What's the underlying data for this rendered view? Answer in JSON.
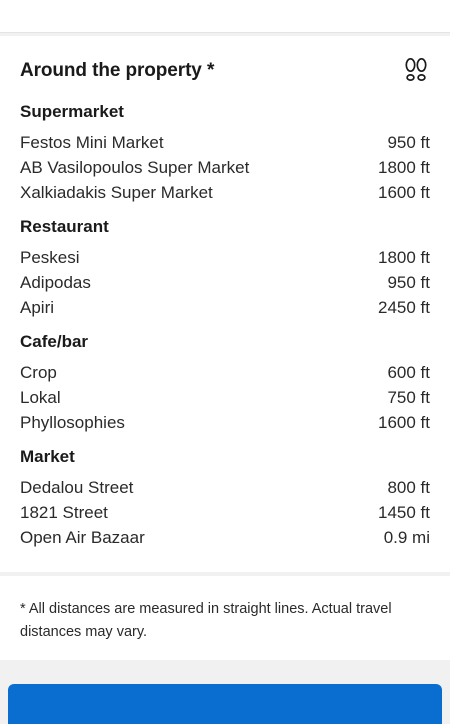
{
  "header": {
    "title": "Around the property *",
    "icon": "footprints-icon"
  },
  "sections": [
    {
      "title": "Supermarket",
      "items": [
        {
          "name": "Festos Mini Market",
          "distance": "950 ft"
        },
        {
          "name": "AB Vasilopoulos Super Market",
          "distance": "1800 ft"
        },
        {
          "name": "Xalkiadakis Super Market",
          "distance": "1600 ft"
        }
      ]
    },
    {
      "title": "Restaurant",
      "items": [
        {
          "name": "Peskesi",
          "distance": "1800 ft"
        },
        {
          "name": "Adipodas",
          "distance": "950 ft"
        },
        {
          "name": "Apiri",
          "distance": "2450 ft"
        }
      ]
    },
    {
      "title": "Cafe/bar",
      "items": [
        {
          "name": "Crop",
          "distance": "600 ft"
        },
        {
          "name": "Lokal",
          "distance": "750 ft"
        },
        {
          "name": "Phyllosophies",
          "distance": "1600 ft"
        }
      ]
    },
    {
      "title": "Market",
      "items": [
        {
          "name": "Dedalou Street",
          "distance": "800 ft"
        },
        {
          "name": "1821 Street",
          "distance": "1450 ft"
        },
        {
          "name": "Open Air Bazaar",
          "distance": "0.9 mi"
        }
      ]
    }
  ],
  "footnote": "* All distances are measured in straight lines. Actual travel distances may vary.",
  "colors": {
    "accent": "#0a6ed1",
    "background": "#f1f1f1"
  }
}
